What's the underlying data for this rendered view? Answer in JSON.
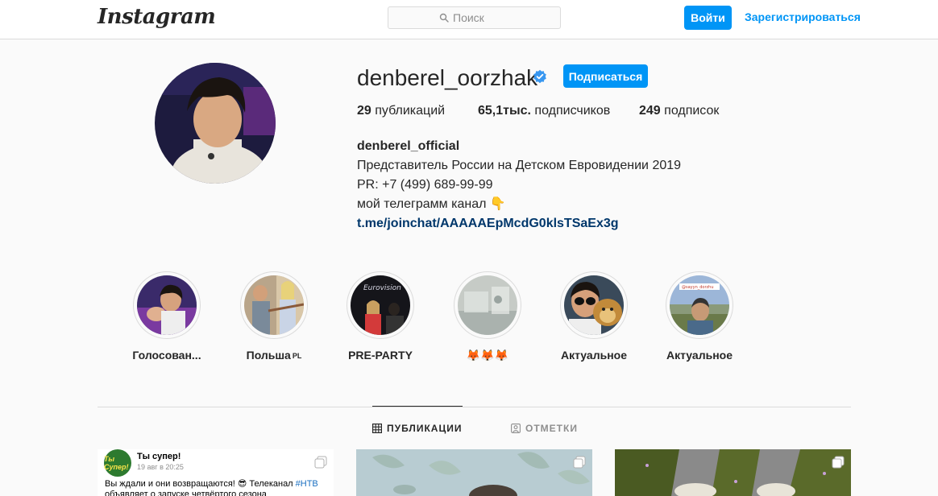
{
  "header": {
    "logo": "Instagram",
    "search_placeholder": "Поиск",
    "login_label": "Войти",
    "register_label": "Зарегистрироваться"
  },
  "profile": {
    "username": "denberel_oorzhak",
    "verified_icon": "verified-badge-icon",
    "follow_label": "Подписаться",
    "stats": [
      {
        "value": "29",
        "label": " публикаций"
      },
      {
        "value": "65,1тыс.",
        "label": " подписчиков"
      },
      {
        "value": "249",
        "label": " подписок"
      }
    ],
    "bio": {
      "name": "denberel_official",
      "line1": "Представитель России на Детском Евровидении 2019",
      "line2": "PR: +7 (499) 689-99-99",
      "line3": "мой телеграмм канал 👇",
      "link": "t.me/joinchat/AAAAAEpMcdG0klsTSaEx3g"
    }
  },
  "highlights": [
    {
      "label": "Голосован..."
    },
    {
      "label": "Польша",
      "tag": "PL"
    },
    {
      "label": "PRE-PARTY",
      "image_text": "Eurovision"
    },
    {
      "label": "🦊🦊🦊"
    },
    {
      "label": "Актуальное"
    },
    {
      "label": "Актуальное",
      "image_text": "@sayyn_dorzhu"
    }
  ],
  "tabs": [
    {
      "label": "Публикации",
      "icon": "grid-icon",
      "active": true
    },
    {
      "label": "Отметки",
      "icon": "tagged-icon",
      "active": false
    }
  ],
  "posts": {
    "first": {
      "logo_text": "Ты Супер!",
      "name": "Ты супер!",
      "date": "19 авг в 20:25",
      "text_start": "Вы ждали и они возвращаются! 😎 Телеканал ",
      "hashtag": "#НТВ",
      "line2": "объявляет о запуске четвёртого сезона"
    },
    "multi_icon": "carousel-icon"
  },
  "colors": {
    "accent": "#0095f6",
    "link": "#00376b",
    "border": "#dbdbdb",
    "background": "#fafafa"
  }
}
